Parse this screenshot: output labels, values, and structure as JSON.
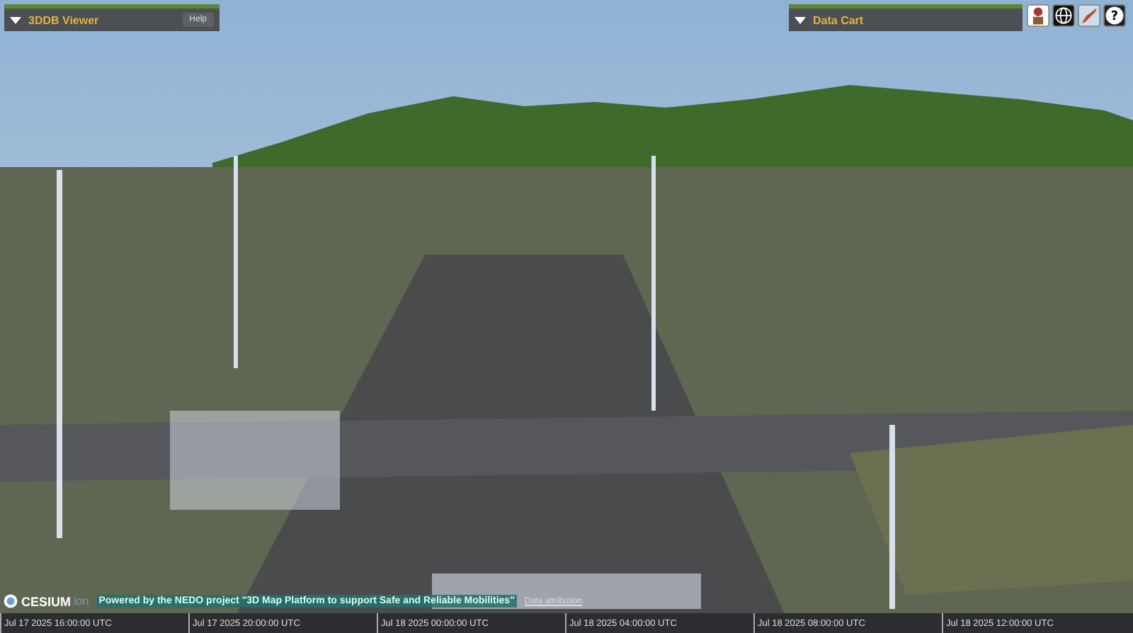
{
  "viewer_panel": {
    "title": "3DDB Viewer",
    "expanded": true,
    "help_button": "Help"
  },
  "data_cart_panel": {
    "title": "Data Cart",
    "expanded": true
  },
  "help_icon": "?",
  "credits": {
    "logo_text": "CESIUM",
    "logo_suffix": "ion",
    "notice": "Powered by the NEDO project \"3D Map Platform to support Safe and Reliable Mobilities\"",
    "link": "Data attribution"
  },
  "timeline": {
    "labels": [
      "Jul 17 2025 16:00:00 UTC",
      "Jul 17 2025 20:00:00 UTC",
      "Jul 18 2025 00:00:00 UTC",
      "Jul 18 2025 04:00:00 UTC",
      "Jul 18 2025 08:00:00 UTC",
      "Jul 18 2025 12:00:00 UTC"
    ]
  }
}
